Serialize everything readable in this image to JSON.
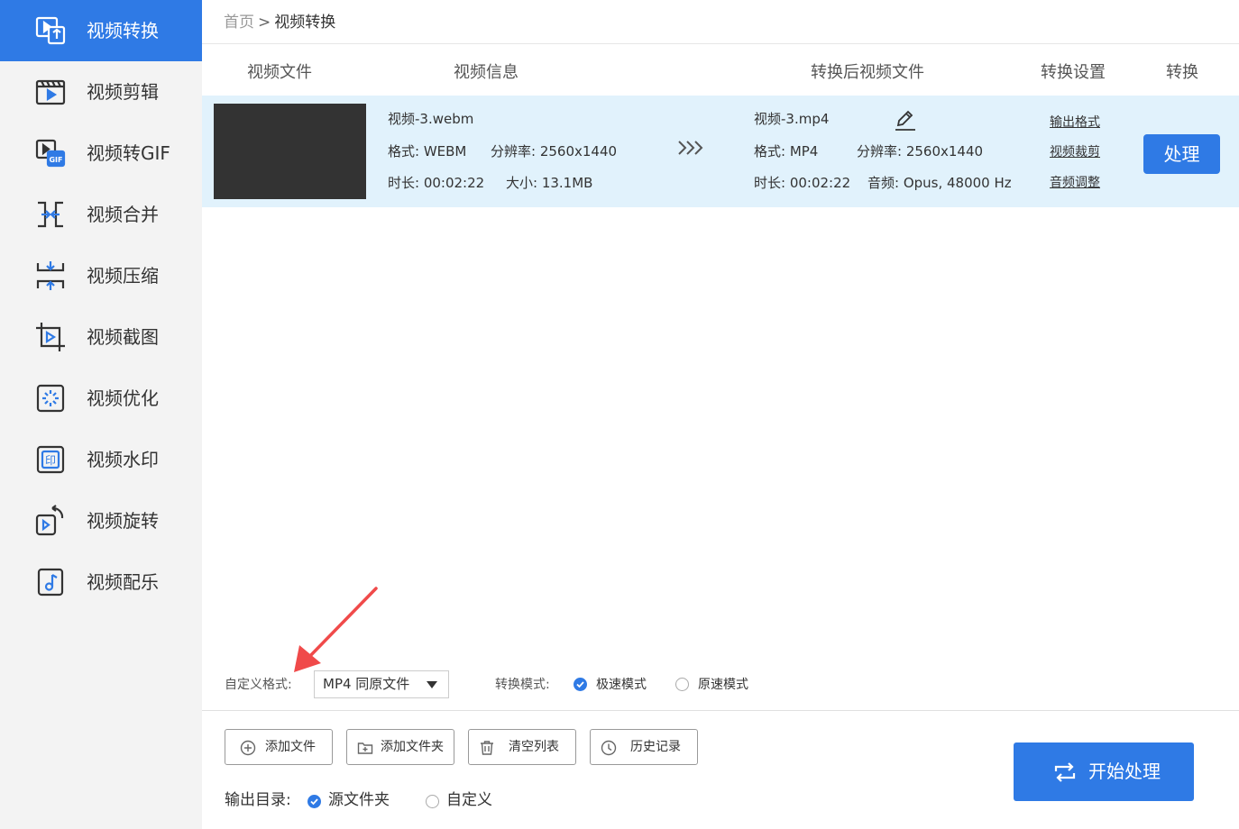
{
  "sidebar": {
    "items": [
      {
        "label": "视频转换",
        "icon": "video-convert-icon",
        "active": true
      },
      {
        "label": "视频剪辑",
        "icon": "video-clip-icon"
      },
      {
        "label": "视频转GIF",
        "icon": "video-to-gif-icon"
      },
      {
        "label": "视频合并",
        "icon": "video-merge-icon"
      },
      {
        "label": "视频压缩",
        "icon": "video-compress-icon"
      },
      {
        "label": "视频截图",
        "icon": "video-screenshot-icon"
      },
      {
        "label": "视频优化",
        "icon": "video-optimize-icon"
      },
      {
        "label": "视频水印",
        "icon": "video-watermark-icon"
      },
      {
        "label": "视频旋转",
        "icon": "video-rotate-icon"
      },
      {
        "label": "视频配乐",
        "icon": "video-music-icon"
      }
    ]
  },
  "breadcrumb": {
    "home": "首页",
    "current": "视频转换"
  },
  "table": {
    "headers": {
      "file": "视频文件",
      "info": "视频信息",
      "output": "转换后视频文件",
      "settings": "转换设置",
      "convert": "转换"
    },
    "rows": [
      {
        "source": {
          "name": "视频-3.webm",
          "format": "格式: WEBM",
          "resolution": "分辨率: 2560x1440",
          "duration": "时长: 00:02:22",
          "size": "大小: 13.1MB"
        },
        "output": {
          "name": "视频-3.mp4",
          "format": "格式: MP4",
          "resolution": "分辨率: 2560x1440",
          "duration": "时长: 00:02:22",
          "audio": "音频: Opus, 48000 Hz"
        },
        "settings_links": [
          "输出格式",
          "视频裁剪",
          "音频调整"
        ],
        "process_label": "处理"
      }
    ]
  },
  "format": {
    "label": "自定义格式:",
    "selected": "MP4 同原文件"
  },
  "mode": {
    "label": "转换模式:",
    "options": [
      "极速模式",
      "原速模式"
    ],
    "selected": "极速模式"
  },
  "toolbar": {
    "add_file": "添加文件",
    "add_folder": "添加文件夹",
    "clear_list": "清空列表",
    "history": "历史记录"
  },
  "output_dir": {
    "label": "输出目录:",
    "options": [
      "源文件夹",
      "自定义"
    ],
    "selected": "源文件夹"
  },
  "start_button": "开始处理",
  "colors": {
    "accent": "#2f7ae5",
    "row_highlight": "#e1f2fc",
    "annotation_arrow": "#f04a4a"
  }
}
